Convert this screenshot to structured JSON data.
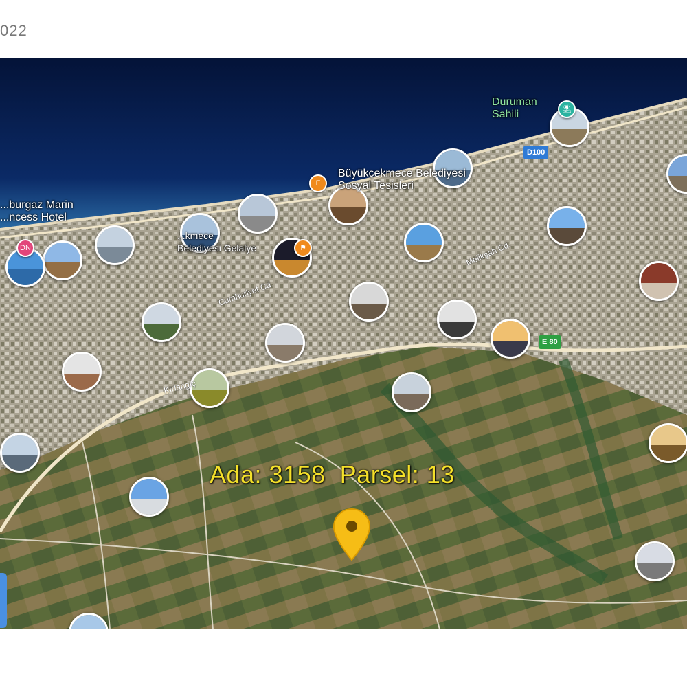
{
  "header": {
    "date_fragment": "022"
  },
  "map": {
    "labels": {
      "duruman": "Duruman\nSahili",
      "buyukcekmece_sosyal": "Büyükçekmece Belediyesi\nSosyal Tesisleri",
      "marin_hotel": "...burgaz Marin\n...ncess Hotel",
      "belediyesi_gelalye": "...kmece\nBelediyesi Gelalye"
    },
    "road_labels": {
      "meliksah": "Melikşah Cd.",
      "cumhuriyet": "Cumhuriyet Cd.",
      "kirlangic": "Kırlangıç"
    },
    "shields": {
      "d100": "D100",
      "e80": "E 80"
    },
    "poi_badges": {
      "pink": "DN",
      "orange": "F"
    },
    "parcel": {
      "ada_label": "Ada: 3158",
      "parsel_label": "Parsel: 13"
    }
  },
  "colors": {
    "sea_deep": "#061a4a",
    "sea_shallow": "#1d4f8e",
    "urban": "#b8b1a2",
    "fields": "#6f6a46",
    "road": "#f1e6c9",
    "label_yellow": "#f4e02a",
    "pin": "#f6bd16",
    "shield_blue": "#2f7bd6",
    "shield_green": "#2ea043"
  },
  "icons": {
    "pin": "map-pin-icon",
    "photos": "photo-thumbnail-icon"
  }
}
